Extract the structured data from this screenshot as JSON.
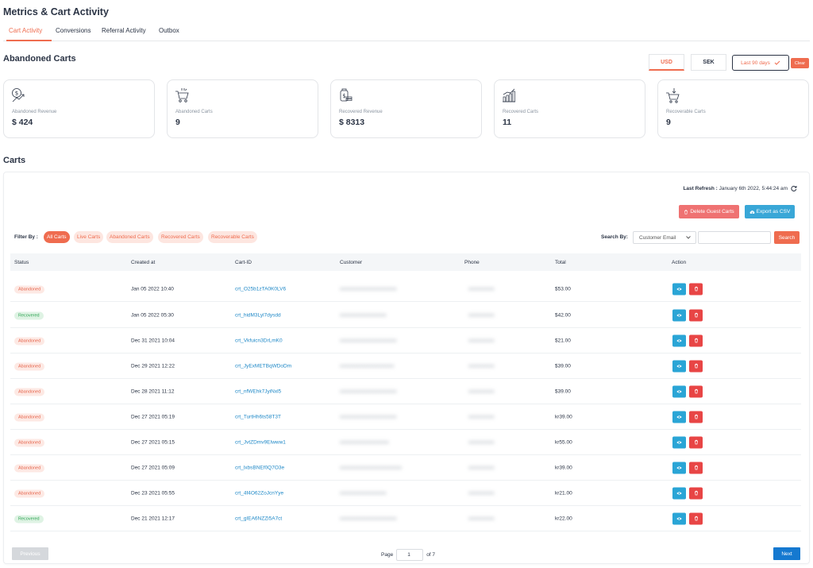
{
  "page": {
    "title": "Metrics & Cart Activity"
  },
  "tabs": [
    {
      "label": "Cart Activity",
      "active": true
    },
    {
      "label": "Conversions"
    },
    {
      "label": "Referral Activity"
    },
    {
      "label": "Outbox"
    }
  ],
  "abandoned_section": {
    "title": "Abandoned Carts"
  },
  "currency": {
    "options": [
      "USD",
      "SEK"
    ],
    "selected": "USD"
  },
  "date_filter": {
    "label": "Last 90 days",
    "clear_label": "Clear"
  },
  "stats": [
    {
      "label": "Abandoned Revenue",
      "value": "$ 424",
      "icon": "revenue-chart-icon"
    },
    {
      "label": "Abandoned Carts",
      "value": "9",
      "icon": "cart-icon"
    },
    {
      "label": "Recovered Revenue",
      "value": "$ 8313",
      "icon": "money-icon"
    },
    {
      "label": "Recovered Carts",
      "value": "11",
      "icon": "bar-chart-icon"
    },
    {
      "label": "Recoverable Carts",
      "value": "9",
      "icon": "cart-download-icon"
    }
  ],
  "carts_section": {
    "title": "Carts"
  },
  "refresh": {
    "label": "Last Refresh :",
    "value": "January 6th 2022, 5:44:24 am"
  },
  "actions": {
    "delete_guest": "Delete Guest Carts",
    "export_csv": "Export as CSV"
  },
  "filters": {
    "label": "Filter By :",
    "options": [
      "All Carts",
      "Live Carts",
      "Abandoned Carts",
      "Recovered Carts",
      "Recoverable Carts"
    ],
    "selected": "All Carts"
  },
  "search": {
    "label": "Search By:",
    "field": "Customer Email",
    "value": "",
    "button": "Search"
  },
  "table": {
    "columns": [
      "Status",
      "Created at",
      "Cart-ID",
      "Customer",
      "Phone",
      "Total",
      "Action"
    ],
    "rows": [
      {
        "status": "Abandoned",
        "created": "Jan 05 2022 10:40",
        "cart_id": "crt_O25b1zTA0K0LV6",
        "customer": "xxxxxxxxxxxxxxxxxxxxxx",
        "phone": "xxxxxxxxxx",
        "total": "$53.00"
      },
      {
        "status": "Recovered",
        "created": "Jan 05 2022 05:30",
        "cart_id": "crt_hidM3Lyl7dysdd",
        "customer": "xxxxxxxxxxxxxxxxxx",
        "phone": "xxxxxxxxxx",
        "total": "$42.00"
      },
      {
        "status": "Abandoned",
        "created": "Dec 31 2021 10:04",
        "cart_id": "crt_Vkfuicn3DrLmK0",
        "customer": "xxxxxxxxxxxxxxxxxxxxxx",
        "phone": "xxxxxxxxxx",
        "total": "$21.00"
      },
      {
        "status": "Abandoned",
        "created": "Dec 29 2021 12:22",
        "cart_id": "crt_JyExMETBqWDoDm",
        "customer": "xxxxxxxxxxxxxxxxxxxxx",
        "phone": "xxxxxxxxxx",
        "total": "$39.00"
      },
      {
        "status": "Abandoned",
        "created": "Dec 28 2021 11:12",
        "cart_id": "crt_nfWEhk7JyiNxl5",
        "customer": "xxxxxxxxxxxxxxxxxxxxxx",
        "phone": "xxxxxxxxxx",
        "total": "$39.00"
      },
      {
        "status": "Abandoned",
        "created": "Dec 27 2021 05:19",
        "cart_id": "crt_TurtHh6ts58T3T",
        "customer": "xxxxxxxxxxxxxxxxxxxxxx",
        "phone": "xxxxxxxxxx",
        "total": "kr39.00"
      },
      {
        "status": "Abandoned",
        "created": "Dec 27 2021 05:15",
        "cart_id": "crt_JvtZDmv9EIwww1",
        "customer": "xxxxxxxxxxxxxxxxxxx",
        "phone": "xxxxxxxxxx",
        "total": "kr55.00"
      },
      {
        "status": "Abandoned",
        "created": "Dec 27 2021 05:09",
        "cart_id": "crt_lxbsBNEf0Q7O3e",
        "customer": "xxxxxxxxxxxxxxxxxxxxxxxx",
        "phone": "xxxxxxxxxx",
        "total": "kr39.00"
      },
      {
        "status": "Abandoned",
        "created": "Dec 23 2021 05:55",
        "cart_id": "crt_4f4O62ZoJcnYye",
        "customer": "xxxxxxxxxxxxxxxxxx",
        "phone": "xxxxxxxxxx",
        "total": "kr21.00"
      },
      {
        "status": "Recovered",
        "created": "Dec 21 2021 12:17",
        "cart_id": "crt_gIEA6NZZi5A7ct",
        "customer": "xxxxxxxxxxxxxxxxxxxxxx",
        "phone": "xxxxxxxxxx",
        "total": "kr22.00"
      }
    ]
  },
  "pagination": {
    "previous": "Previous",
    "page_label": "Page",
    "current": "1",
    "of_label": "of 7",
    "next": "Next"
  },
  "colors": {
    "accent": "#ef6c4f",
    "blue": "#39a7d7",
    "primary": "#1579d0",
    "danger": "#e84545",
    "success": "#2ca352"
  }
}
